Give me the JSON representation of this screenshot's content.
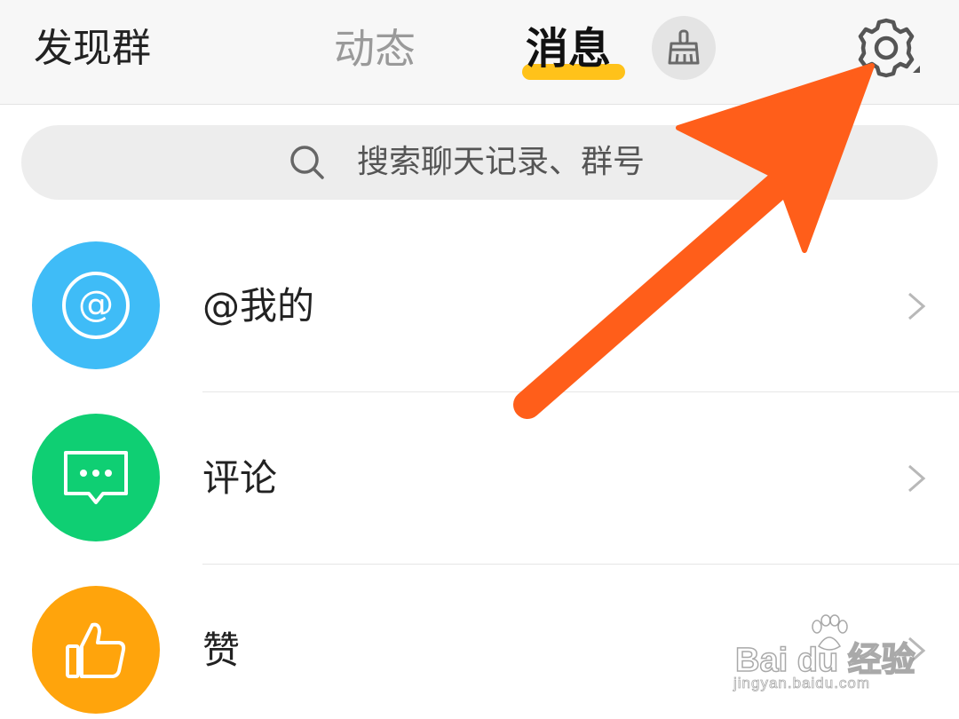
{
  "header": {
    "discover_label": "发现群",
    "tabs": [
      {
        "label": "动态",
        "active": false
      },
      {
        "label": "消息",
        "active": true
      }
    ],
    "active_underline_color": "#ffc21a",
    "broom_icon": "broom-icon",
    "settings_icon": "gear-icon"
  },
  "search": {
    "placeholder": "搜索聊天记录、群号",
    "icon": "search-icon"
  },
  "list": {
    "items": [
      {
        "label": "@我的",
        "icon": "at-icon",
        "color": "#3fbcf7"
      },
      {
        "label": "评论",
        "icon": "comment-icon",
        "color": "#0fcf73"
      },
      {
        "label": "赞",
        "icon": "thumbs-up-icon",
        "color": "#ffa40c"
      }
    ]
  },
  "annotation": {
    "arrow_color": "#ff5e1a"
  },
  "watermark": {
    "main": "Bai du 经验",
    "sub": "jingyan.baidu.com"
  }
}
